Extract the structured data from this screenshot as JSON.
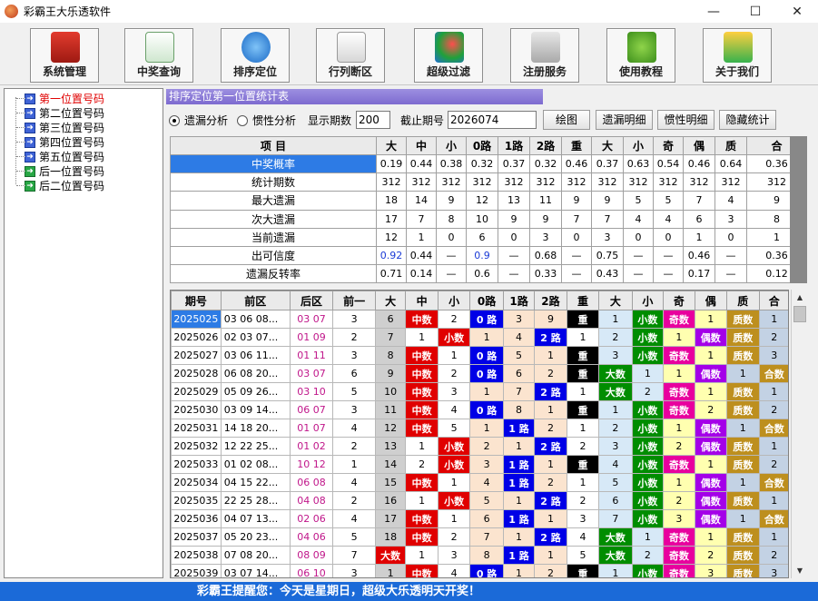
{
  "window": {
    "title": "彩霸王大乐透软件"
  },
  "toolbar": [
    {
      "label": "系统管理",
      "icon": "toolbox-icon"
    },
    {
      "label": "中奖查询",
      "icon": "search-document-icon"
    },
    {
      "label": "排序定位",
      "icon": "compass-icon"
    },
    {
      "label": "行列断区",
      "icon": "grid-pencil-icon"
    },
    {
      "label": "超级过滤",
      "icon": "filter-gems-icon"
    },
    {
      "label": "注册服务",
      "icon": "key-icon"
    },
    {
      "label": "使用教程",
      "icon": "user-tutorial-icon"
    },
    {
      "label": "关于我们",
      "icon": "phone-icon"
    }
  ],
  "tree": [
    {
      "label": "第一位置号码",
      "selected": true,
      "icon": "arrow"
    },
    {
      "label": "第二位置号码",
      "icon": "arrow"
    },
    {
      "label": "第三位置号码",
      "icon": "arrow"
    },
    {
      "label": "第四位置号码",
      "icon": "arrow"
    },
    {
      "label": "第五位置号码",
      "icon": "arrow"
    },
    {
      "label": "后一位置号码",
      "icon": "arrow-green"
    },
    {
      "label": "后二位置号码",
      "icon": "arrow-green"
    }
  ],
  "panel": {
    "title": "排序定位第一位置统计表"
  },
  "controls": {
    "radio1": "遗漏分析",
    "radio2": "惯性分析",
    "period_label": "显示期数",
    "period_value": "200",
    "cutoff_label": "截止期号",
    "cutoff_value": "2026074",
    "btn_draw": "绘图",
    "btn_miss": "遗漏明细",
    "btn_inertia": "惯性明细",
    "btn_hide": "隐藏统计"
  },
  "stats": {
    "item_header": "项 目",
    "columns": [
      "大",
      "中",
      "小",
      "0路",
      "1路",
      "2路",
      "重",
      "大",
      "小",
      "奇",
      "偶",
      "质",
      "合"
    ],
    "rows": [
      {
        "label": "中奖概率",
        "values": [
          "0.19",
          "0.44",
          "0.38",
          "0.32",
          "0.37",
          "0.32",
          "0.46",
          "0.37",
          "0.63",
          "0.54",
          "0.46",
          "0.64",
          "0.36"
        ]
      },
      {
        "label": "统计期数",
        "values": [
          "312",
          "312",
          "312",
          "312",
          "312",
          "312",
          "312",
          "312",
          "312",
          "312",
          "312",
          "312",
          "312"
        ]
      },
      {
        "label": "最大遗漏",
        "values": [
          "18",
          "14",
          "9",
          "12",
          "13",
          "11",
          "9",
          "9",
          "5",
          "5",
          "7",
          "4",
          "9"
        ]
      },
      {
        "label": "次大遗漏",
        "values": [
          "17",
          "7",
          "8",
          "10",
          "9",
          "9",
          "7",
          "7",
          "4",
          "4",
          "6",
          "3",
          "8"
        ]
      },
      {
        "label": "当前遗漏",
        "values": [
          "12",
          "1",
          "0",
          "6",
          "0",
          "3",
          "0",
          "3",
          "0",
          "0",
          "1",
          "0",
          "1"
        ]
      },
      {
        "label": "出可信度",
        "values": [
          "0.92",
          "0.44",
          "—",
          "0.9",
          "—",
          "0.68",
          "—",
          "0.75",
          "—",
          "—",
          "0.46",
          "—",
          "0.36"
        ]
      },
      {
        "label": "遗漏反转率",
        "values": [
          "0.71",
          "0.14",
          "—",
          "0.6",
          "—",
          "0.33",
          "—",
          "0.43",
          "—",
          "—",
          "0.17",
          "—",
          "0.12"
        ]
      }
    ]
  },
  "history": {
    "columns": [
      "期号",
      "前区",
      "后区",
      "前一",
      "大",
      "中",
      "小",
      "0路",
      "1路",
      "2路",
      "重",
      "大",
      "小",
      "奇",
      "偶",
      "质",
      "合"
    ],
    "rows": [
      {
        "period": "2025025",
        "front": "03 06 08...",
        "back": "03 07",
        "first": "3",
        "cells": [
          "6",
          "中数",
          "2",
          "0 路",
          "3",
          "9",
          "重",
          "1",
          "小数",
          "奇数",
          "1",
          "质数",
          "1"
        ]
      },
      {
        "period": "2025026",
        "front": "02 03 07...",
        "back": "01 09",
        "first": "2",
        "cells": [
          "7",
          "1",
          "小数",
          "1",
          "4",
          "2 路",
          "1",
          "2",
          "小数",
          "1",
          "偶数",
          "质数",
          "2"
        ]
      },
      {
        "period": "2025027",
        "front": "03 06 11...",
        "back": "01 11",
        "first": "3",
        "cells": [
          "8",
          "中数",
          "1",
          "0 路",
          "5",
          "1",
          "重",
          "3",
          "小数",
          "奇数",
          "1",
          "质数",
          "3"
        ]
      },
      {
        "period": "2025028",
        "front": "06 08 20...",
        "back": "03 07",
        "first": "6",
        "cells": [
          "9",
          "中数",
          "2",
          "0 路",
          "6",
          "2",
          "重",
          "大数",
          "1",
          "1",
          "偶数",
          "1",
          "合数"
        ]
      },
      {
        "period": "2025029",
        "front": "05 09 26...",
        "back": "03 10",
        "first": "5",
        "cells": [
          "10",
          "中数",
          "3",
          "1",
          "7",
          "2 路",
          "1",
          "大数",
          "2",
          "奇数",
          "1",
          "质数",
          "1"
        ]
      },
      {
        "period": "2025030",
        "front": "03 09 14...",
        "back": "06 07",
        "first": "3",
        "cells": [
          "11",
          "中数",
          "4",
          "0 路",
          "8",
          "1",
          "重",
          "1",
          "小数",
          "奇数",
          "2",
          "质数",
          "2"
        ]
      },
      {
        "period": "2025031",
        "front": "14 18 20...",
        "back": "01 07",
        "first": "4",
        "cells": [
          "12",
          "中数",
          "5",
          "1",
          "1 路",
          "2",
          "1",
          "2",
          "小数",
          "1",
          "偶数",
          "1",
          "合数"
        ]
      },
      {
        "period": "2025032",
        "front": "12 22 25...",
        "back": "01 02",
        "first": "2",
        "cells": [
          "13",
          "1",
          "小数",
          "2",
          "1",
          "2 路",
          "2",
          "3",
          "小数",
          "2",
          "偶数",
          "质数",
          "1"
        ]
      },
      {
        "period": "2025033",
        "front": "01 02 08...",
        "back": "10 12",
        "first": "1",
        "cells": [
          "14",
          "2",
          "小数",
          "3",
          "1 路",
          "1",
          "重",
          "4",
          "小数",
          "奇数",
          "1",
          "质数",
          "2"
        ]
      },
      {
        "period": "2025034",
        "front": "04 15 22...",
        "back": "06 08",
        "first": "4",
        "cells": [
          "15",
          "中数",
          "1",
          "4",
          "1 路",
          "2",
          "1",
          "5",
          "小数",
          "1",
          "偶数",
          "1",
          "合数"
        ]
      },
      {
        "period": "2025035",
        "front": "22 25 28...",
        "back": "04 08",
        "first": "2",
        "cells": [
          "16",
          "1",
          "小数",
          "5",
          "1",
          "2 路",
          "2",
          "6",
          "小数",
          "2",
          "偶数",
          "质数",
          "1"
        ]
      },
      {
        "period": "2025036",
        "front": "04 07 13...",
        "back": "02 06",
        "first": "4",
        "cells": [
          "17",
          "中数",
          "1",
          "6",
          "1 路",
          "1",
          "3",
          "7",
          "小数",
          "3",
          "偶数",
          "1",
          "合数"
        ]
      },
      {
        "period": "2025037",
        "front": "05 20 23...",
        "back": "04 06",
        "first": "5",
        "cells": [
          "18",
          "中数",
          "2",
          "7",
          "1",
          "2 路",
          "4",
          "大数",
          "1",
          "奇数",
          "1",
          "质数",
          "1"
        ]
      },
      {
        "period": "2025038",
        "front": "07 08 20...",
        "back": "08 09",
        "first": "7",
        "cells": [
          "大数",
          "1",
          "3",
          "8",
          "1 路",
          "1",
          "5",
          "大数",
          "2",
          "奇数",
          "2",
          "质数",
          "2"
        ]
      },
      {
        "period": "2025039",
        "front": "03 07 14...",
        "back": "06 10",
        "first": "3",
        "cells": [
          "1",
          "中数",
          "4",
          "0 路",
          "1",
          "2",
          "重",
          "1",
          "小数",
          "奇数",
          "3",
          "质数",
          "3"
        ]
      }
    ]
  },
  "status": {
    "text": "彩霸王提醒您：今天是星期日，超级大乐透明天开奖！"
  },
  "colors": {
    "accent": "#2d7be5",
    "status_bg": "#1b6ad8",
    "header_purple": "#8a7bd8"
  }
}
